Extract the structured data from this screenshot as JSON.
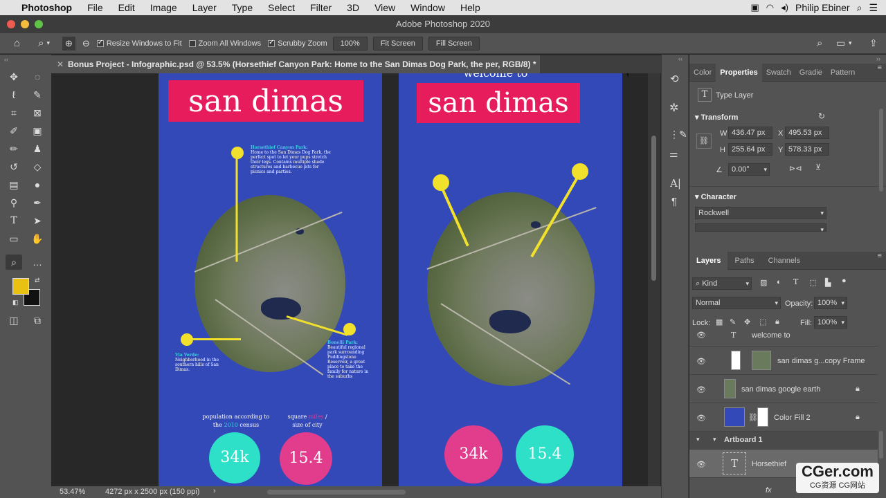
{
  "menubar": {
    "app": "Photoshop",
    "items": [
      "File",
      "Edit",
      "Image",
      "Layer",
      "Type",
      "Select",
      "Filter",
      "3D",
      "View",
      "Window",
      "Help"
    ],
    "user": "Philip Ebiner"
  },
  "titlebar": {
    "title": "Adobe Photoshop 2020"
  },
  "options": {
    "resize_windows": "Resize Windows to Fit",
    "zoom_all": "Zoom All Windows",
    "scrubby": "Scrubby Zoom",
    "zoom_value": "100%",
    "fit_screen": "Fit Screen",
    "fill_screen": "Fill Screen"
  },
  "document": {
    "tab_title": "Bonus Project - Infographic.psd @ 53.5% (Horsethief Canyon Park: Home to the San Dimas Dog Park, the per, RGB/8) *"
  },
  "artboards": {
    "left": {
      "title": "san dimas",
      "ann1_head": "Horsethief Canyon Park:",
      "ann1_body": "Home to the San Dimas Dog Park, the perfect spot to let your pups stretch their legs. Contains multiple shade structures and barbecue pits for picnics and parties.",
      "ann2_head": "Via Verde:",
      "ann2_body": "Neighborhood in the southern hills of San Dimas.",
      "ann3_head": "Bonelli Park:",
      "ann3_body": "Beautiful regional park surrounding Puddingstone Reservoir, a great place to take the family for nature in the suburbs",
      "cap1_a": "population according to",
      "cap1_b": "the",
      "cap1_year": "2010",
      "cap1_c": "census",
      "cap2_a": "square",
      "cap2_miles": "miles",
      "cap2_b": "/",
      "cap2_c": "size of city",
      "stat1": "34k",
      "stat2": "15.4"
    },
    "right": {
      "partial_heading": "welcome to",
      "title": "san dimas",
      "stat1": "34k",
      "stat2": "15.4"
    }
  },
  "statusbar": {
    "zoom": "53.47%",
    "doc_info": "4272 px x 2500 px (150 ppi)",
    "arrow": "›"
  },
  "properties": {
    "tabs": [
      "Color",
      "Properties",
      "Swatch",
      "Gradie",
      "Pattern"
    ],
    "type_layer": "Type Layer",
    "transform_label": "Transform",
    "w_label": "W",
    "w_value": "436.47 px",
    "x_label": "X",
    "x_value": "495.53 px",
    "h_label": "H",
    "h_value": "255.64 px",
    "y_label": "Y",
    "y_value": "578.33 px",
    "angle_value": "0.00°",
    "character_label": "Character",
    "font_value": "Rockwell"
  },
  "layers": {
    "tabs": [
      "Layers",
      "Paths",
      "Channels"
    ],
    "kind": "Kind",
    "blend": "Normal",
    "opacity_label": "Opacity:",
    "opacity_value": "100%",
    "lock_label": "Lock:",
    "fill_label": "Fill:",
    "fill_value": "100%",
    "rows": [
      {
        "name": "welcome to"
      },
      {
        "name": "san dimas g...copy Frame"
      },
      {
        "name": "san dimas google earth"
      },
      {
        "name": "Color Fill 2"
      },
      {
        "name": "Artboard 1"
      },
      {
        "name": "Horsethief"
      }
    ]
  },
  "watermark": {
    "main": "CGer.com",
    "sub": "CG资源 CG网站"
  },
  "colors": {
    "foreground": "#e8c113",
    "background": "#111111",
    "artboard": "#3449b8",
    "title_pink": "#e61c5d",
    "teal": "#2ee0c8",
    "pink": "#e23c8c",
    "pin_yellow": "#f2e12c"
  }
}
